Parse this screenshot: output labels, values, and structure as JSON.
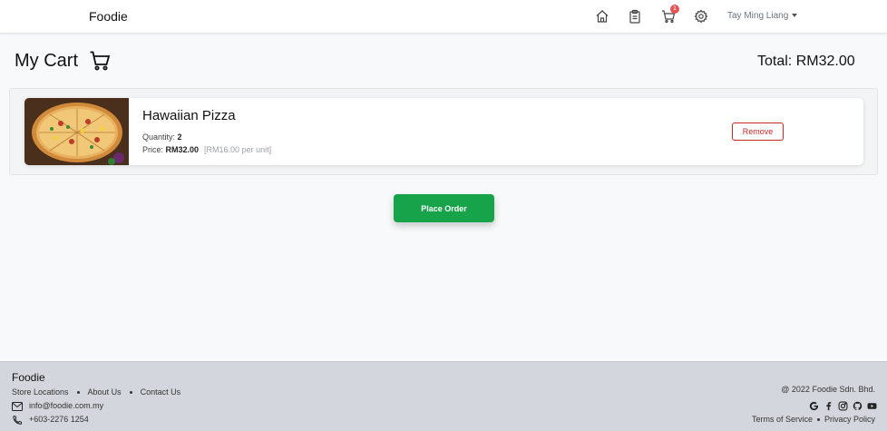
{
  "navbar": {
    "brand": "Foodie",
    "cart_badge": "1",
    "user_name": "Tay Ming Liang",
    "icons": [
      "home-icon",
      "orders-clipboard-icon",
      "cart-icon",
      "settings-gear-icon"
    ]
  },
  "page": {
    "title": "My Cart",
    "total_label": "Total: ",
    "total_value": "RM32.00"
  },
  "cart": {
    "items": [
      {
        "name": "Hawaiian Pizza",
        "quantity_label": "Quantity: ",
        "quantity": "2",
        "price_label": "Price: ",
        "price": "RM32.00",
        "unit_note": "[RM16.00 per unit]",
        "remove_label": "Remove",
        "image": "pizza-photo"
      }
    ],
    "place_order_label": "Place Order"
  },
  "footer": {
    "brand": "Foodie",
    "links": [
      "Store Locations",
      "About Us",
      "Contact Us"
    ],
    "email": "info@foodie.com.my",
    "phone": "+603-2276 1254",
    "copyright": "@ 2022 Foodie Sdn. Bhd.",
    "socials": [
      "google-icon",
      "facebook-icon",
      "instagram-icon",
      "github-icon",
      "youtube-icon"
    ],
    "legal": [
      "Terms of Service",
      "Privacy Policy"
    ]
  },
  "colors": {
    "accent_green": "#16a34a",
    "remove_red": "#c62828",
    "badge_red": "#e55353",
    "footer_bg": "#d3d6dc"
  }
}
